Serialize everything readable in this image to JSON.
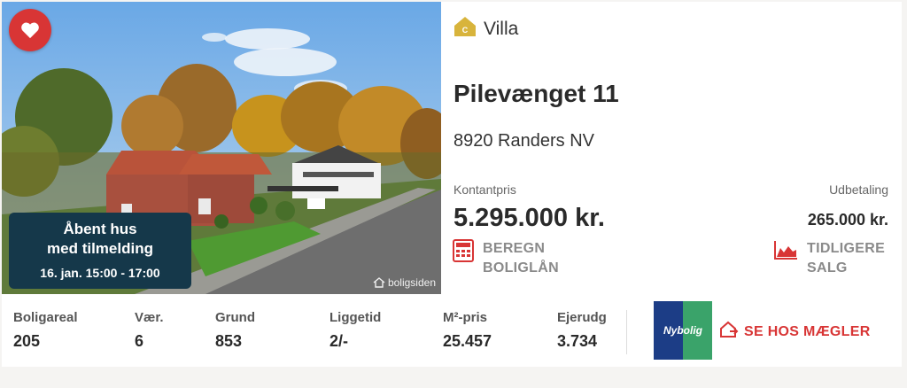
{
  "listing": {
    "open_house": {
      "line1": "Åbent hus",
      "line2": "med tilmelding",
      "line3": "16. jan. 15:00 - 17:00"
    },
    "watermark": "boligsiden",
    "type_label": "Villa",
    "type_icon_letter": "C",
    "address": "Pilevænget 11",
    "city": "8920 Randers NV",
    "kontantpris_label": "Kontantpris",
    "kontantpris_value": "5.295.000 kr.",
    "udbetaling_label": "Udbetaling",
    "udbetaling_value": "265.000 kr.",
    "actions": {
      "loan_line1": "BEREGN",
      "loan_line2": "BOLIGLÅN",
      "sales_line1": "TIDLIGERE",
      "sales_line2": "SALG"
    }
  },
  "stats": [
    {
      "label": "Boligareal",
      "value": "205"
    },
    {
      "label": "Vær.",
      "value": "6"
    },
    {
      "label": "Grund",
      "value": "853"
    },
    {
      "label": "Liggetid",
      "value": "2/-"
    },
    {
      "label": "M²-pris",
      "value": "25.457"
    },
    {
      "label": "Ejerudg",
      "value": "3.734"
    }
  ],
  "broker": {
    "logo_text": "Nybolig",
    "button_label": "SE HOS MÆGLER"
  },
  "colors": {
    "accent_red": "#d83535",
    "open_house_bg": "#15384a",
    "villa_icon": "#d8b43c"
  },
  "icons": {
    "favorite": "heart-icon",
    "type": "house-icon",
    "loan": "calculator-icon",
    "sales": "area-chart-icon",
    "broker": "external-house-icon"
  }
}
